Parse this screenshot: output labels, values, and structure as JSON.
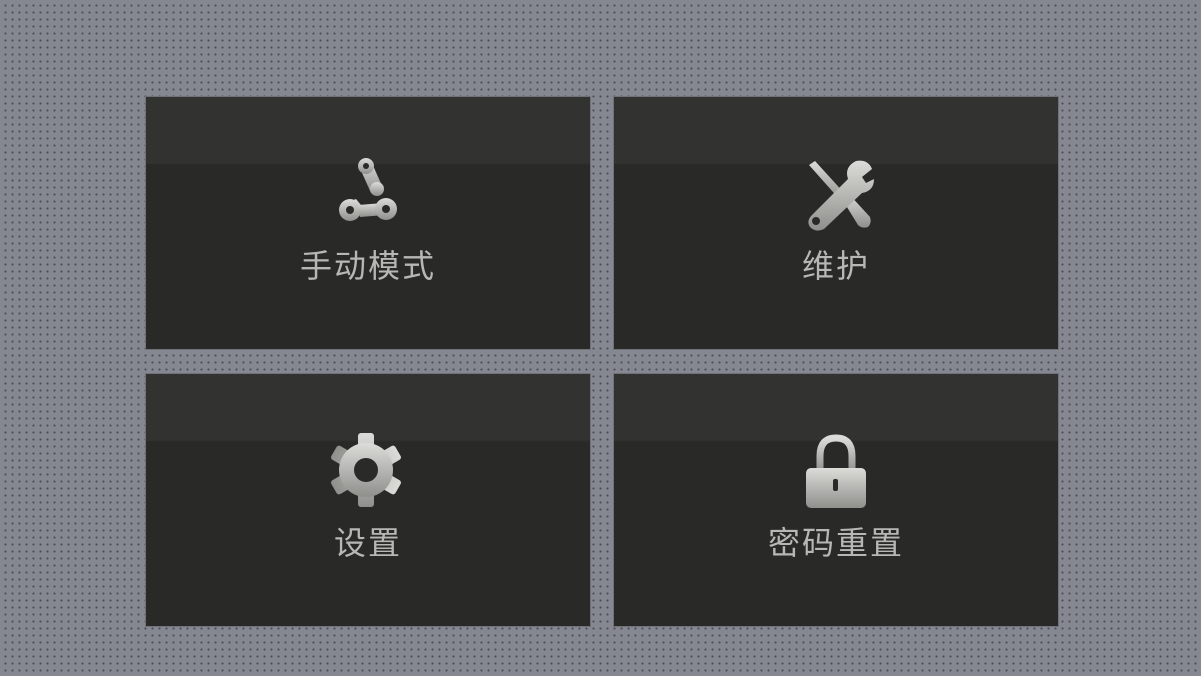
{
  "menu": {
    "items": [
      {
        "label": "手动模式",
        "icon": "chain-link-icon"
      },
      {
        "label": "维护",
        "icon": "wrench-screwdriver-icon"
      },
      {
        "label": "设置",
        "icon": "gear-icon"
      },
      {
        "label": "密码重置",
        "icon": "lock-icon"
      }
    ]
  },
  "colors": {
    "background": "#858891",
    "tile": "#292a27",
    "tile_top": "#323330",
    "label": "#b7b8b4",
    "icon": "#b0b1ad"
  }
}
